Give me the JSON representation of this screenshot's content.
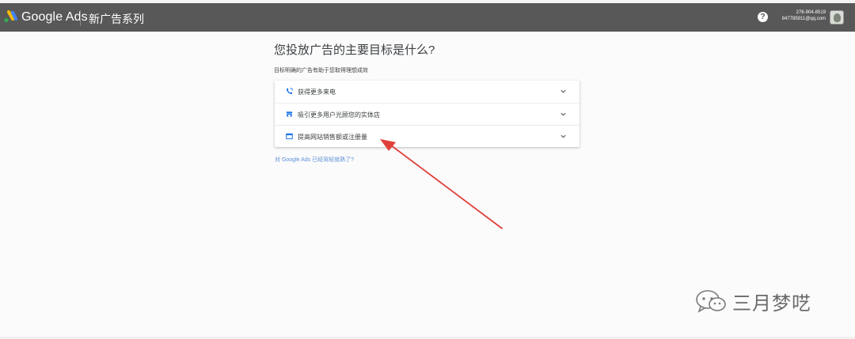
{
  "header": {
    "brand": "Google Ads",
    "campaign_title": "新广告系列",
    "help_glyph": "?",
    "account_phone": "276-904-8519",
    "account_email": "847785911@qq.com",
    "bar_color": "#585858"
  },
  "main": {
    "question": "您投放广告的主要目标是什么?",
    "subtitle": "目标明确的广告有助于您取得理想成效",
    "options": [
      {
        "label": "获得更多来电",
        "icon": "phone-icon"
      },
      {
        "label": "吸引更多用户光顾您的实体店",
        "icon": "store-icon"
      },
      {
        "label": "提高网站销售额或注册量",
        "icon": "website-icon"
      }
    ],
    "expert_link": "对 Google Ads 已经驾轻就熟了?"
  },
  "annotation": {
    "arrow_color": "#e0403a"
  },
  "watermark": {
    "text": "三月梦呓",
    "icon": "wechat-icon"
  }
}
